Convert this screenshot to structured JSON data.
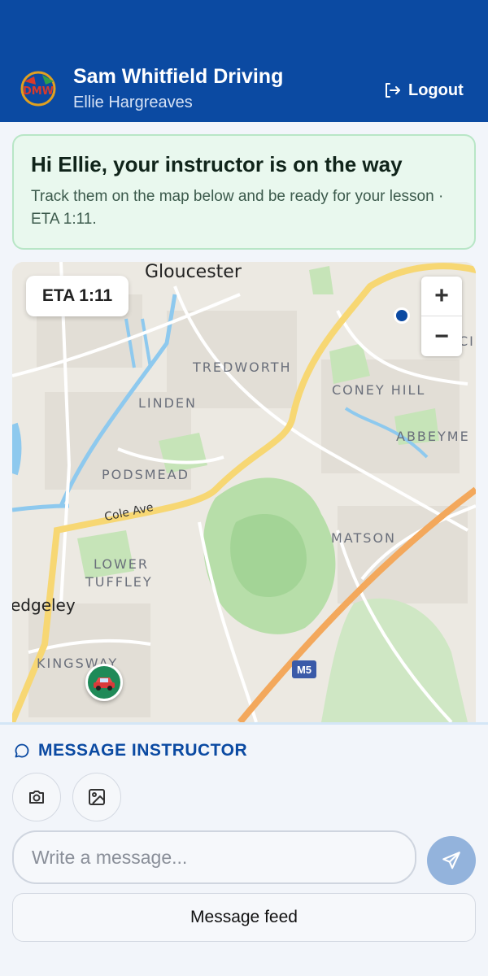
{
  "header": {
    "brand_title": "Sam Whitfield Driving",
    "student_name": "Ellie Hargreaves",
    "logout_label": "Logout",
    "logo_text": "DMW",
    "bg_color": "#0b4aa2"
  },
  "banner": {
    "title": "Hi Ellie, your instructor is on the way",
    "text": "Track them on the map below and be ready for your lesson · ETA 1:11."
  },
  "map": {
    "eta_label": "ETA 1:11",
    "zoom_in": "+",
    "zoom_out": "−",
    "places": {
      "city": "Gloucester",
      "tredworth": "TREDWORTH",
      "linden": "LINDEN",
      "coney_hill": "CONEY HILL",
      "abbeymead": "ABBEYME",
      "podsmead": "PODSMEAD",
      "matson": "MATSON",
      "lower": "LOWER",
      "tuffley": "TUFFLEY",
      "quedgeley": "edgeley",
      "kingsway": "KINGSWAY",
      "edge_c": "CI"
    },
    "road_label": "Cole Ave",
    "motorway_label": "M5",
    "icons": {
      "car_marker": "car-icon",
      "destination": "location-dot-icon"
    }
  },
  "messaging": {
    "section_title": "MESSAGE INSTRUCTOR",
    "input_placeholder": "Write a message...",
    "feed_button": "Message feed",
    "icons": {
      "camera": "camera-icon",
      "gallery": "image-icon",
      "send": "send-icon",
      "chat": "chat-bubble-icon"
    }
  }
}
